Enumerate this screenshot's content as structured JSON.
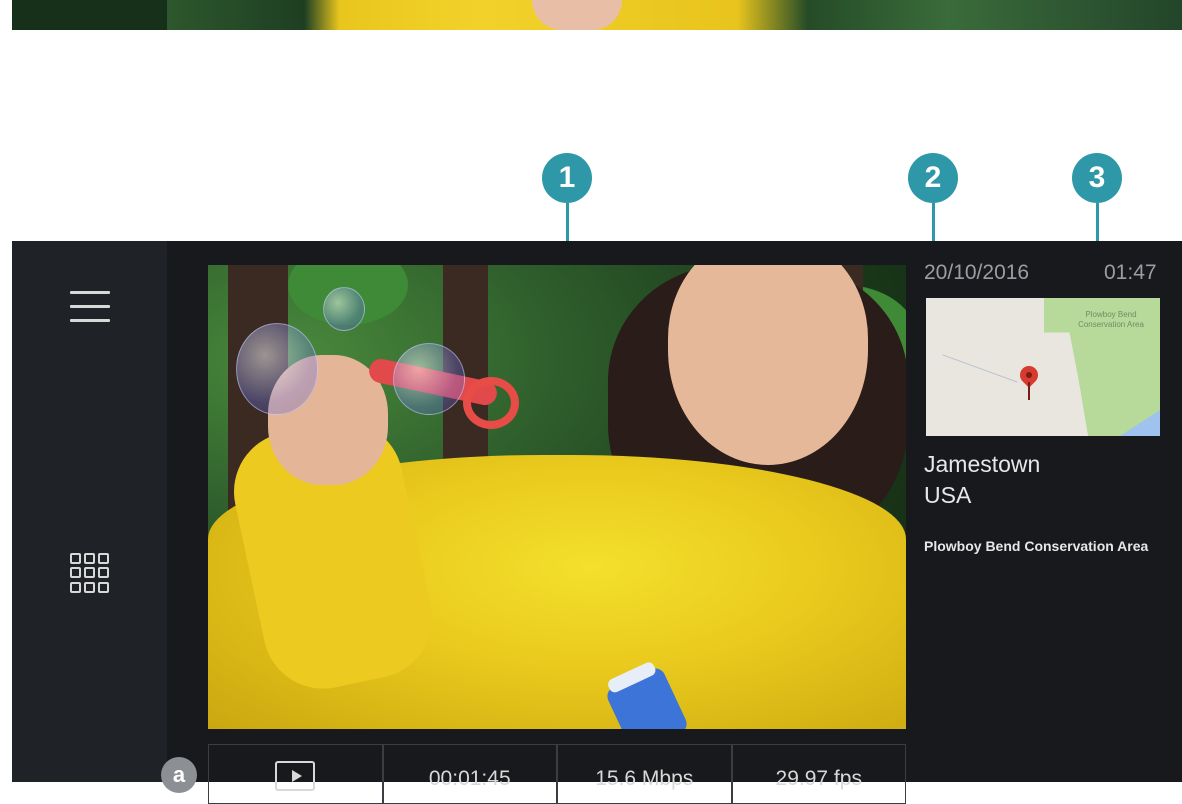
{
  "callouts": [
    "1",
    "2",
    "3"
  ],
  "sidebar": {
    "menu_icon": "hamburger-menu-icon",
    "grid_icon": "grid-view-icon"
  },
  "info": {
    "date": "20/10/2016",
    "time": "01:47",
    "map_label": "Plowboy Bend Conservation Area",
    "city": "Jamestown",
    "country": "USA",
    "place": "Plowboy Bend Conservation Area"
  },
  "controls": {
    "badge": "a",
    "play_icon": "play-icon",
    "duration": "00:01:45",
    "bitrate": "15.6 Mbps",
    "framerate": "29.97 fps"
  },
  "colors": {
    "callout": "#2f98a8",
    "panel_bg": "#17191c",
    "sidebar_bg": "#1f2226"
  }
}
